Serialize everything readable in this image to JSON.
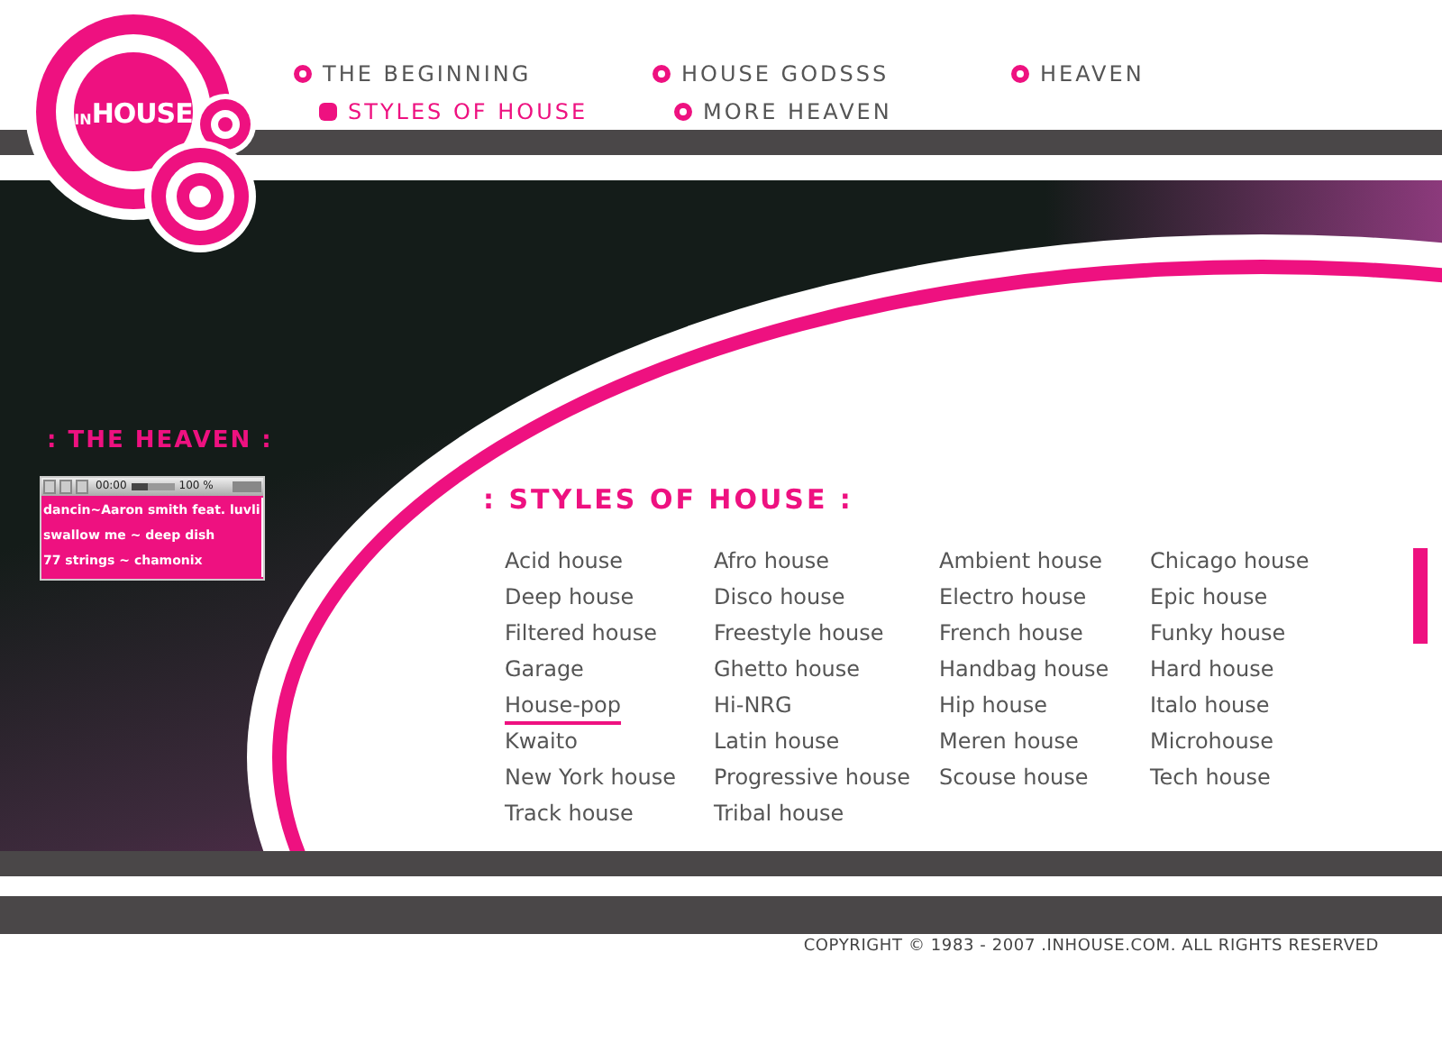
{
  "logo": {
    "prefix": "IN",
    "name": "HOUSE"
  },
  "nav": {
    "rows": [
      [
        {
          "label": "THE BEGINNING",
          "selected": false
        },
        {
          "label": "HOUSE GODSSS",
          "selected": false
        },
        {
          "label": "HEAVEN",
          "selected": false
        }
      ],
      [
        {
          "label": "STYLES OF HOUSE",
          "selected": true
        },
        {
          "label": "MORE HEAVEN",
          "selected": false
        }
      ]
    ]
  },
  "sidebar": {
    "heading": ": THE HEAVEN :",
    "player": {
      "time": "00:00",
      "volume": "100 %",
      "level": 0.35,
      "tracks": [
        "dancin~Aaron smith feat. luvli",
        "swallow me ~ deep dish",
        "77 strings ~ chamonix"
      ]
    }
  },
  "styles": {
    "heading": ": STYLES OF HOUSE :",
    "items": [
      {
        "label": "Acid house",
        "selected": false
      },
      {
        "label": "Afro house",
        "selected": false
      },
      {
        "label": "Ambient house",
        "selected": false
      },
      {
        "label": "Chicago house",
        "selected": false
      },
      {
        "label": "Deep house",
        "selected": false
      },
      {
        "label": "Disco house",
        "selected": false
      },
      {
        "label": "Electro house",
        "selected": false
      },
      {
        "label": "Epic house",
        "selected": false
      },
      {
        "label": "Filtered house",
        "selected": false
      },
      {
        "label": "Freestyle house",
        "selected": false
      },
      {
        "label": "French house",
        "selected": false
      },
      {
        "label": "Funky house",
        "selected": false
      },
      {
        "label": "Garage",
        "selected": false
      },
      {
        "label": "Ghetto house",
        "selected": false
      },
      {
        "label": "Handbag house",
        "selected": false
      },
      {
        "label": "Hard house",
        "selected": false
      },
      {
        "label": "House-pop",
        "selected": true
      },
      {
        "label": "Hi-NRG",
        "selected": false
      },
      {
        "label": "Hip house",
        "selected": false
      },
      {
        "label": "Italo house",
        "selected": false
      },
      {
        "label": "Kwaito",
        "selected": false
      },
      {
        "label": "Latin house",
        "selected": false
      },
      {
        "label": "Meren house",
        "selected": false
      },
      {
        "label": "Microhouse",
        "selected": false
      },
      {
        "label": "New York house",
        "selected": false
      },
      {
        "label": "Progressive house",
        "selected": false
      },
      {
        "label": "Scouse house",
        "selected": false
      },
      {
        "label": "Tech house",
        "selected": false
      },
      {
        "label": "Track house",
        "selected": false
      },
      {
        "label": "Tribal house",
        "selected": false
      }
    ]
  },
  "footer": {
    "copyright": "COPYRIGHT © 1983 - 2007 .INHOUSE.COM. ALL RIGHTS RESERVED"
  }
}
